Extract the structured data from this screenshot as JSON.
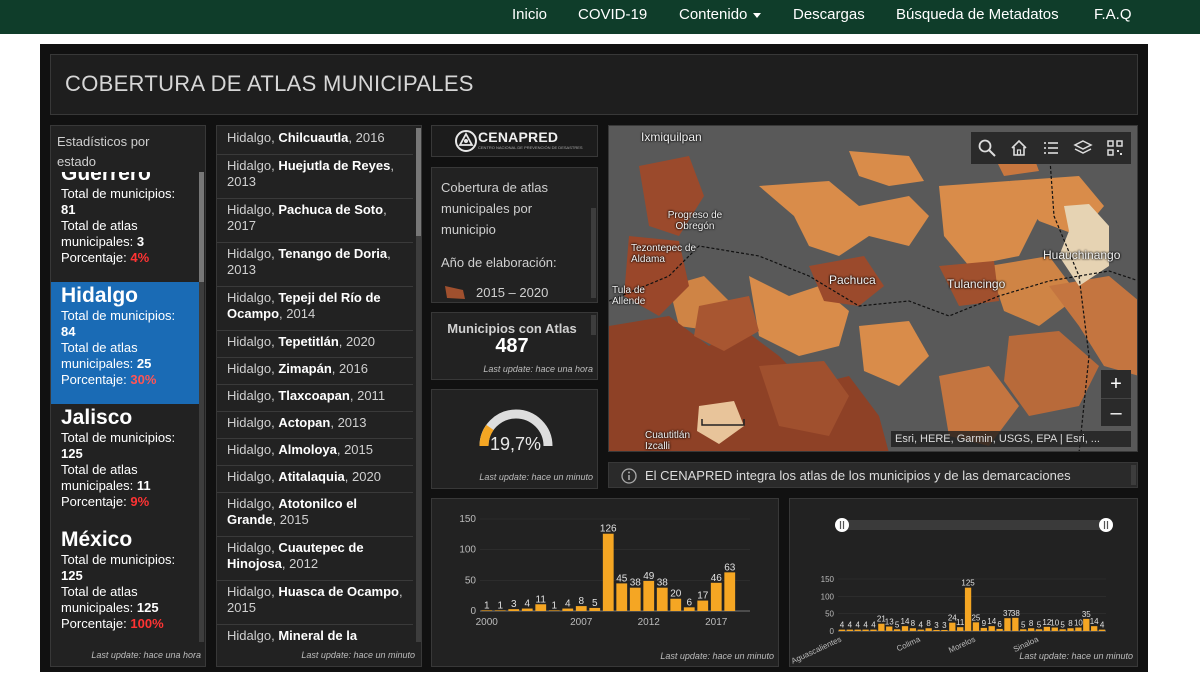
{
  "nav": {
    "items": [
      "Inicio",
      "COVID-19",
      "Contenido",
      "Descargas",
      "Búsqueda de Metadatos",
      "F.A.Q"
    ]
  },
  "dashboard": {
    "title": "COBERTURA DE ATLAS MUNICIPALES"
  },
  "stats_panel": {
    "title": "Estadísticos por estado",
    "footnote": "Last update: hace una hora",
    "items": [
      {
        "name": "Guerrero",
        "total_label": "Total de municipios:",
        "total": "81",
        "atlas_label": "Total de atlas municipales:",
        "atlas": "3",
        "pct_label": "Porcentaje:",
        "pct": "4%",
        "selected": false
      },
      {
        "name": "Hidalgo",
        "total_label": "Total de municipios:",
        "total": "84",
        "atlas_label": "Total de atlas municipales:",
        "atlas": "25",
        "pct_label": "Porcentaje:",
        "pct": "30%",
        "selected": true
      },
      {
        "name": "Jalisco",
        "total_label": "Total de municipios:",
        "total": "125",
        "atlas_label": "Total de atlas municipales:",
        "atlas": "11",
        "pct_label": "Porcentaje:",
        "pct": "9%",
        "selected": false
      },
      {
        "name": "México",
        "total_label": "Total de municipios:",
        "total": "125",
        "atlas_label": "Total de atlas municipales:",
        "atlas": "125",
        "pct_label": "Porcentaje:",
        "pct": "100%",
        "selected": false
      }
    ]
  },
  "muni_panel": {
    "footnote": "Last update: hace un minuto",
    "items": [
      {
        "state": "Hidalgo,",
        "name": "Chilcuautla",
        "year": "2016"
      },
      {
        "state": "Hidalgo,",
        "name": "Huejutla de Reyes",
        "year": "2013"
      },
      {
        "state": "Hidalgo,",
        "name": "Pachuca de Soto",
        "year": "2017"
      },
      {
        "state": "Hidalgo,",
        "name": "Tenango de Doria",
        "year": "2013"
      },
      {
        "state": "Hidalgo,",
        "name": "Tepeji del Río de Ocampo",
        "year": "2014"
      },
      {
        "state": "Hidalgo,",
        "name": "Tepetitlán",
        "year": "2020"
      },
      {
        "state": "Hidalgo,",
        "name": "Zimapán",
        "year": "2016"
      },
      {
        "state": "Hidalgo,",
        "name": "Tlaxcoapan",
        "year": "2011"
      },
      {
        "state": "Hidalgo,",
        "name": "Actopan",
        "year": "2013"
      },
      {
        "state": "Hidalgo,",
        "name": "Almoloya",
        "year": "2015"
      },
      {
        "state": "Hidalgo,",
        "name": "Atitalaquia",
        "year": "2020"
      },
      {
        "state": "Hidalgo,",
        "name": "Atotonilco el Grande",
        "year": "2015"
      },
      {
        "state": "Hidalgo,",
        "name": "Cuautepec de Hinojosa",
        "year": "2012"
      },
      {
        "state": "Hidalgo,",
        "name": "Huasca de Ocampo",
        "year": "2015"
      },
      {
        "state": "Hidalgo,",
        "name": "Mineral de la",
        "year": ""
      }
    ]
  },
  "logo": {
    "name": "CENAPRED",
    "subtitle": "CENTRO NACIONAL DE PREVENCIÓN DE DESASTRES"
  },
  "legend": {
    "title": "Cobertura de atlas municipales por municipio",
    "subtitle": "Año de elaboración:",
    "item_label": "2015 – 2020",
    "item_color": "#a0502e"
  },
  "count": {
    "title": "Municipios con Atlas",
    "value": "487",
    "footnote": "Last update: hace una hora"
  },
  "gauge": {
    "value_text": "19,7%",
    "fraction": 0.197,
    "footnote": "Last update: hace un minuto",
    "fill_color": "#f5a623"
  },
  "map": {
    "labels": [
      "Ixmiquilpan",
      "Progreso de Obregón",
      "Tezontepec de Aldama",
      "Tula de Allende",
      "Pachuca",
      "Tulancingo",
      "Huauchinango",
      "Cuautitlán Izcalli"
    ],
    "attribution": "Esri, HERE, Garmin, USGS, EPA | Esri, ...",
    "zoom_in": "+",
    "zoom_out": "–",
    "tools": [
      "search-icon",
      "home-icon",
      "list-icon",
      "layers-icon",
      "qr-icon"
    ]
  },
  "info": {
    "text": "El CENAPRED integra los atlas de los  municipios y de las demarcaciones"
  },
  "colors": {
    "accent": "#1a6bb5",
    "bar": "#f5a623",
    "pct_red": "#ff3333",
    "nav_bg": "#0f3d2a"
  },
  "chart_data": [
    {
      "type": "bar",
      "x": [
        2000,
        2001,
        2002,
        2003,
        2004,
        2005,
        2006,
        2007,
        2008,
        2009,
        2010,
        2011,
        2012,
        2013,
        2014,
        2015,
        2016,
        2017,
        2018,
        2019
      ],
      "values": [
        1,
        1,
        3,
        4,
        11,
        1,
        4,
        8,
        5,
        126,
        45,
        38,
        49,
        38,
        20,
        6,
        17,
        46,
        63,
        0
      ],
      "value_labels": [
        "1",
        "1",
        "3",
        "4",
        "11",
        "1",
        "4",
        "8",
        "5",
        "126",
        "45",
        "38",
        "49",
        "38",
        "20",
        "6",
        "17",
        "46",
        "63",
        ""
      ],
      "x_tick_labels": [
        "2000",
        "2007",
        "2012",
        "2017"
      ],
      "y_tick_labels": [
        "0",
        "50",
        "100",
        "150"
      ],
      "ylim": [
        0,
        150
      ],
      "footnote": "Last update: hace un minuto"
    },
    {
      "type": "bar",
      "values": [
        4,
        4,
        4,
        4,
        4,
        21,
        13,
        5,
        14,
        8,
        4,
        8,
        3,
        3,
        24,
        11,
        125,
        25,
        9,
        14,
        6,
        37,
        38,
        5,
        8,
        5,
        12,
        10,
        5,
        8,
        10,
        35,
        14,
        4
      ],
      "value_labels": [
        "4",
        "4",
        "4",
        "4",
        "4",
        "21",
        "13",
        "5",
        "14",
        "8",
        "4",
        "8",
        "3",
        "3",
        "24",
        "11",
        "125",
        "25",
        "9",
        "14",
        "6",
        "37",
        "38",
        "5",
        "8",
        "5",
        "12",
        "10",
        "5",
        "8",
        "10",
        "35",
        "14",
        "4"
      ],
      "x_tick_labels": [
        "Aguascalientes",
        "Colima",
        "Morelos",
        "Sinaloa"
      ],
      "y_tick_labels": [
        "0",
        "50",
        "100",
        "150"
      ],
      "ylim": [
        0,
        150
      ],
      "footnote": "Last update: hace un minuto"
    }
  ]
}
